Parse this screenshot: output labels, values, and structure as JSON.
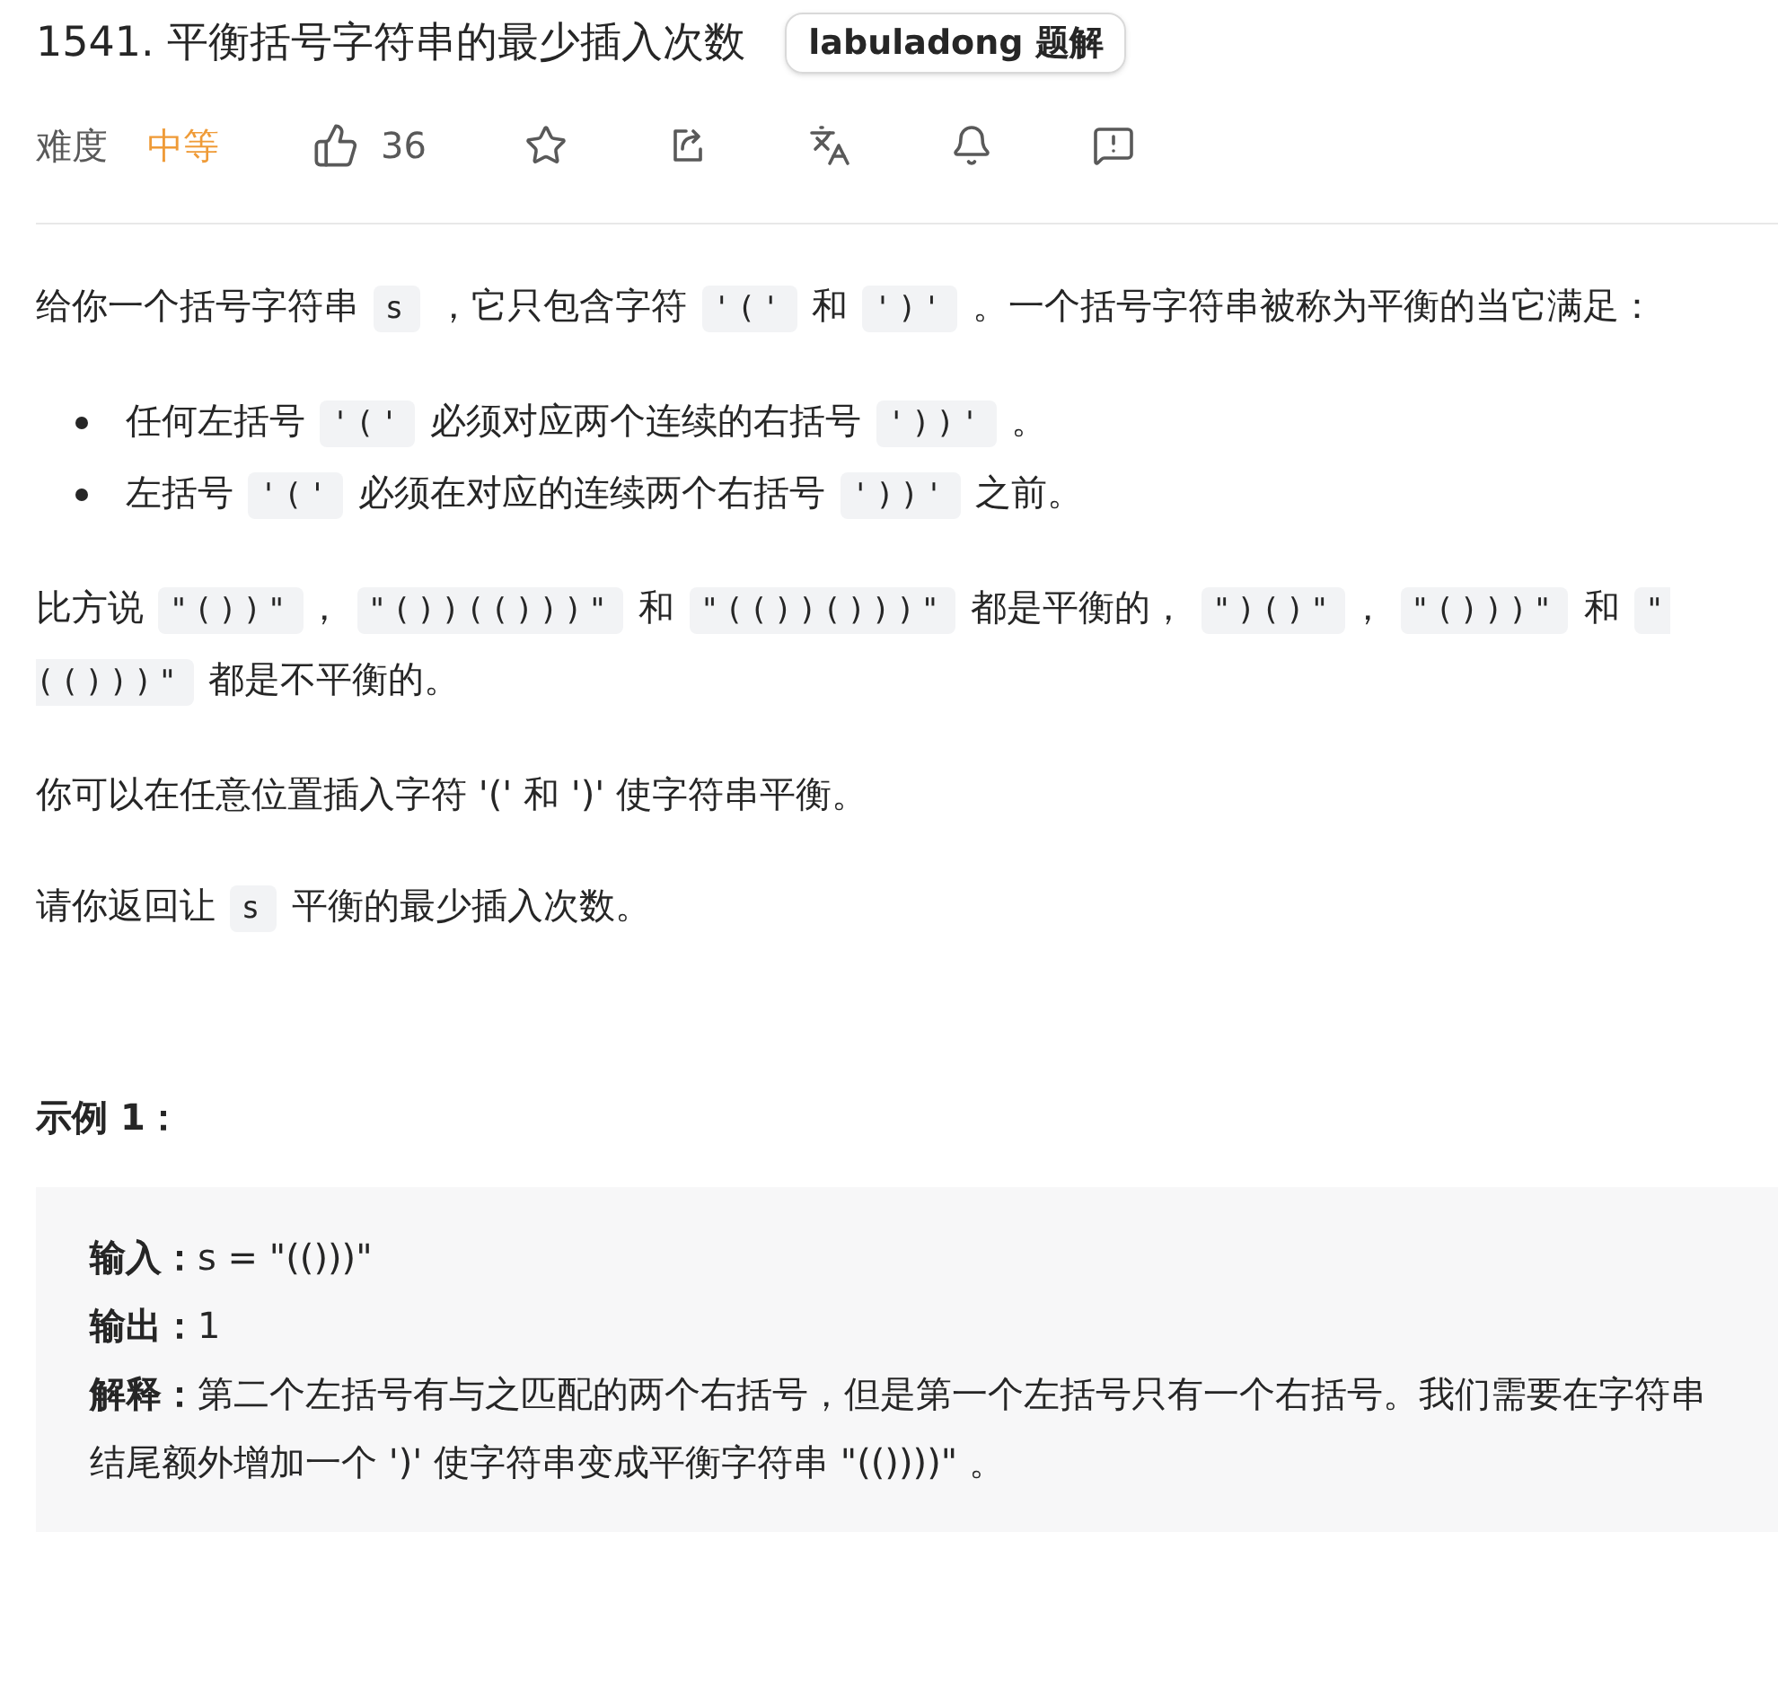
{
  "title": "1541. 平衡括号字符串的最少插入次数",
  "badge": "labuladong 题解",
  "meta": {
    "difficulty_label": "难度",
    "difficulty": "中等",
    "likes": "36"
  },
  "toolbar": [
    {
      "kind": "star"
    },
    {
      "kind": "share"
    },
    {
      "kind": "translate"
    },
    {
      "kind": "bell"
    },
    {
      "kind": "feedback"
    }
  ],
  "description": [
    {
      "kind": "paragraph",
      "parts": [
        {
          "kind": "text",
          "text": "给你一个括号字符串 "
        },
        {
          "kind": "code",
          "text": "s"
        },
        {
          "kind": "text",
          "text": " ，它只包含字符 "
        },
        {
          "kind": "code",
          "text": "'('"
        },
        {
          "kind": "text",
          "text": " 和 "
        },
        {
          "kind": "code",
          "text": "')'"
        },
        {
          "kind": "text",
          "text": " 。一个括号字符串被称为平衡的当它满足："
        }
      ]
    },
    {
      "kind": "list",
      "items": [
        [
          {
            "kind": "text",
            "text": "任何左括号 "
          },
          {
            "kind": "code",
            "text": "'('"
          },
          {
            "kind": "text",
            "text": " 必须对应两个连续的右括号 "
          },
          {
            "kind": "code",
            "text": "'))'"
          },
          {
            "kind": "text",
            "text": " 。"
          }
        ],
        [
          {
            "kind": "text",
            "text": "左括号 "
          },
          {
            "kind": "code",
            "text": "'('"
          },
          {
            "kind": "text",
            "text": " 必须在对应的连续两个右括号 "
          },
          {
            "kind": "code",
            "text": "'))'"
          },
          {
            "kind": "text",
            "text": " 之前。"
          }
        ]
      ]
    },
    {
      "kind": "paragraph",
      "parts": [
        {
          "kind": "text",
          "text": "比方说 "
        },
        {
          "kind": "code",
          "text": "\"())\""
        },
        {
          "kind": "text",
          "text": "， "
        },
        {
          "kind": "code",
          "text": "\"())(()))\""
        },
        {
          "kind": "text",
          "text": " 和 "
        },
        {
          "kind": "code",
          "text": "\"(())()))\""
        },
        {
          "kind": "text",
          "text": " 都是平衡的， "
        },
        {
          "kind": "code",
          "text": "\")()\""
        },
        {
          "kind": "text",
          "text": "， "
        },
        {
          "kind": "code",
          "text": "\"()))\""
        },
        {
          "kind": "text",
          "text": " 和 "
        },
        {
          "kind": "code",
          "text": "\"(()))\""
        },
        {
          "kind": "text",
          "text": " 都是不平衡的。"
        }
      ]
    },
    {
      "kind": "paragraph",
      "parts": [
        {
          "kind": "text",
          "text": "你可以在任意位置插入字符 '(' 和 ')' 使字符串平衡。"
        }
      ]
    },
    {
      "kind": "paragraph",
      "parts": [
        {
          "kind": "text",
          "text": "请你返回让 "
        },
        {
          "kind": "code",
          "text": "s"
        },
        {
          "kind": "text",
          "text": " 平衡的最少插入次数。"
        }
      ]
    }
  ],
  "example": {
    "heading": "示例 1：",
    "lines": [
      {
        "label": "输入：",
        "text": "s = \"(()))\""
      },
      {
        "label": "输出：",
        "text": "1"
      },
      {
        "label": "解释：",
        "text": "第二个左括号有与之匹配的两个右括号，但是第一个左括号只有一个右括号。我们需要在字符串结尾额外增加一个 ')' 使字符串变成平衡字符串 \"(())))\" 。"
      }
    ]
  }
}
